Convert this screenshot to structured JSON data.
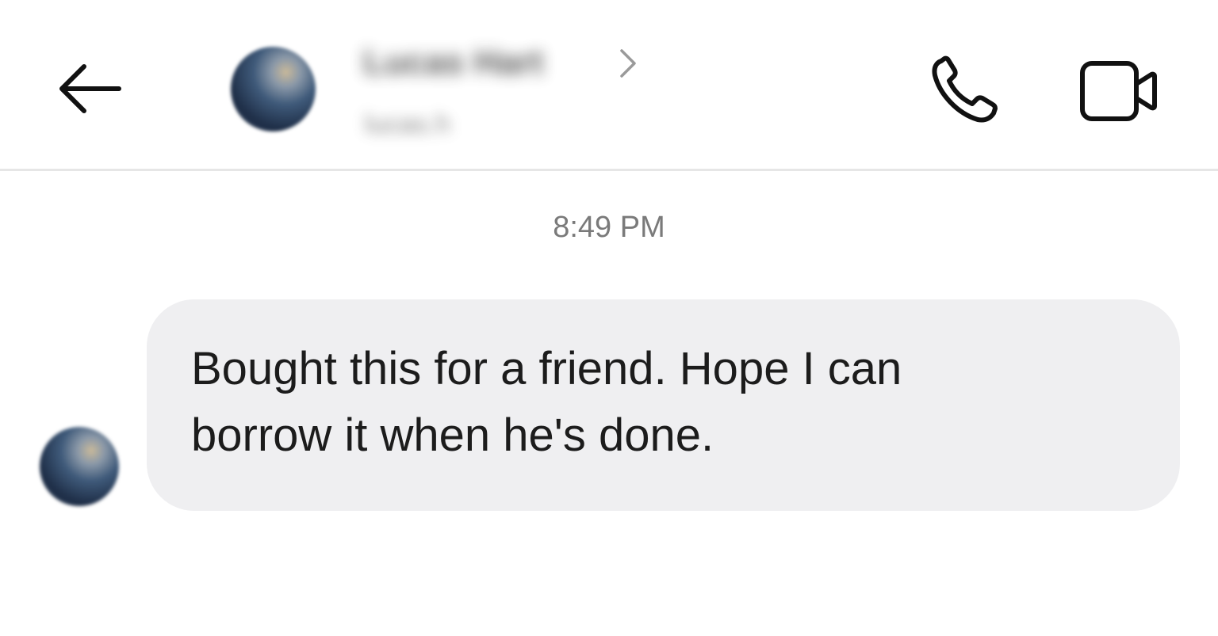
{
  "header": {
    "back_icon": "arrow-left-icon",
    "contact_name": "Lucas Hart",
    "contact_handle": "lucas.h",
    "chevron_icon": "chevron-right-icon",
    "call_icon": "phone-icon",
    "video_icon": "video-camera-icon"
  },
  "conversation": {
    "timestamp": "8:49 PM",
    "messages": [
      {
        "text": "Bought this for a friend. Hope I can borrow it when he's done."
      }
    ]
  },
  "colors": {
    "bubble_bg": "#efeff1",
    "divider": "#e6e6e6",
    "timestamp": "#7a7a7a",
    "icon": "#111111"
  }
}
